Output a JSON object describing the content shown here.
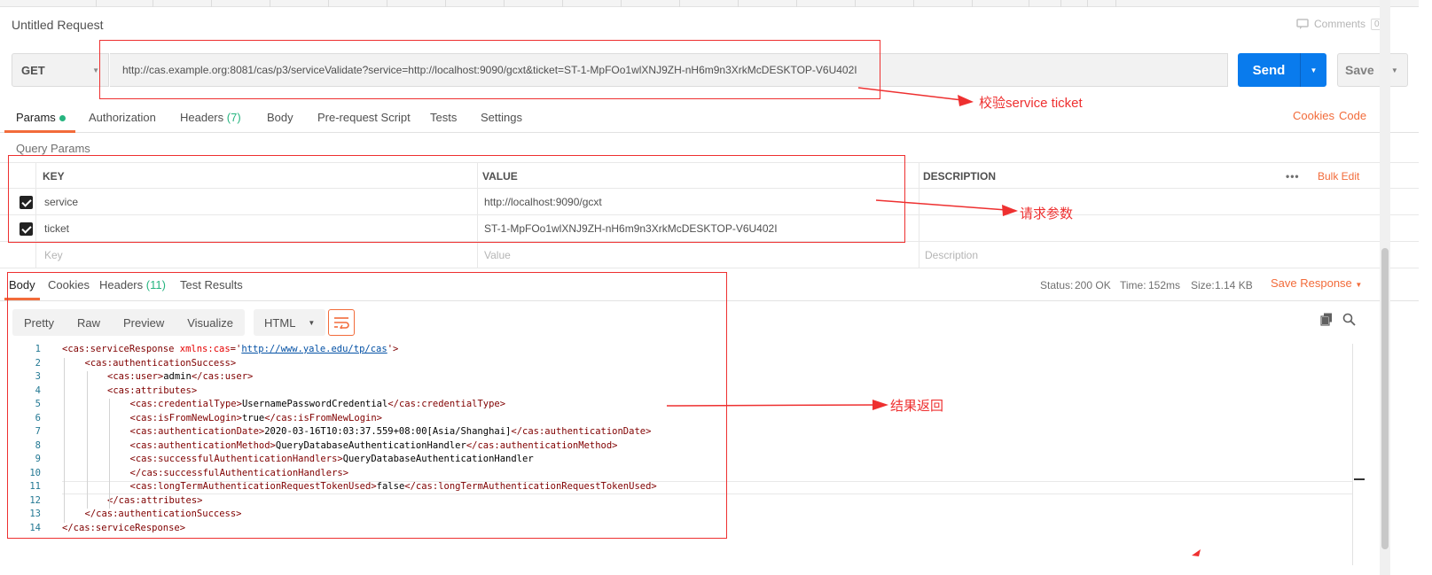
{
  "request": {
    "title": "Untitled Request",
    "comments_label": "Comments",
    "comments_count": "0",
    "method": "GET",
    "url": "http://cas.example.org:8081/cas/p3/serviceValidate?service=http://localhost:9090/gcxt&ticket=ST-1-MpFOo1wlXNJ9ZH-nH6m9n3XrkMcDESKTOP-V6U402I",
    "send_label": "Send",
    "save_label": "Save"
  },
  "request_tabs": {
    "params": "Params",
    "authorization": "Authorization",
    "headers": "Headers",
    "headers_count": "(7)",
    "body": "Body",
    "prerequest": "Pre-request Script",
    "tests": "Tests",
    "settings": "Settings",
    "cookies": "Cookies",
    "code": "Code"
  },
  "query_params": {
    "label": "Query Params",
    "headers": {
      "key": "KEY",
      "value": "VALUE",
      "description": "DESCRIPTION",
      "bulk_edit": "Bulk Edit"
    },
    "rows": [
      {
        "checked": true,
        "key": "service",
        "value": "http://localhost:9090/gcxt"
      },
      {
        "checked": true,
        "key": "ticket",
        "value": "ST-1-MpFOo1wlXNJ9ZH-nH6m9n3XrkMcDESKTOP-V6U402I"
      }
    ],
    "placeholder": {
      "key": "Key",
      "value": "Value",
      "description": "Description"
    }
  },
  "response_tabs": {
    "body": "Body",
    "cookies": "Cookies",
    "headers": "Headers",
    "headers_count": "(11)",
    "test_results": "Test Results"
  },
  "response_status": {
    "status_label": "Status:",
    "status_value": "200 OK",
    "time_label": "Time:",
    "time_value": "152ms",
    "size_label": "Size:",
    "size_value": "1.14 KB",
    "save_response": "Save Response"
  },
  "format_bar": {
    "pretty": "Pretty",
    "raw": "Raw",
    "preview": "Preview",
    "visualize": "Visualize",
    "language": "HTML"
  },
  "code_lines": [
    {
      "n": "1",
      "indent": 0,
      "parts": [
        [
          "t",
          "<cas:serviceResponse "
        ],
        [
          "a",
          "xmlns:cas"
        ],
        [
          "t",
          "='"
        ],
        [
          "s",
          "http://www.yale.edu/tp/cas"
        ],
        [
          "t",
          "'>"
        ]
      ]
    },
    {
      "n": "2",
      "indent": 1,
      "parts": [
        [
          "t",
          "<cas:authenticationSuccess>"
        ]
      ]
    },
    {
      "n": "3",
      "indent": 2,
      "parts": [
        [
          "t",
          "<cas:user>"
        ],
        [
          "p",
          "admin"
        ],
        [
          "t",
          "</cas:user>"
        ]
      ]
    },
    {
      "n": "4",
      "indent": 2,
      "parts": [
        [
          "t",
          "<cas:attributes>"
        ]
      ]
    },
    {
      "n": "5",
      "indent": 3,
      "parts": [
        [
          "t",
          "<cas:credentialType>"
        ],
        [
          "p",
          "UsernamePasswordCredential"
        ],
        [
          "t",
          "</cas:credentialType>"
        ]
      ]
    },
    {
      "n": "6",
      "indent": 3,
      "parts": [
        [
          "t",
          "<cas:isFromNewLogin>"
        ],
        [
          "p",
          "true"
        ],
        [
          "t",
          "</cas:isFromNewLogin>"
        ]
      ]
    },
    {
      "n": "7",
      "indent": 3,
      "parts": [
        [
          "t",
          "<cas:authenticationDate>"
        ],
        [
          "p",
          "2020-03-16T10:03:37.559+08:00[Asia/Shanghai]"
        ],
        [
          "t",
          "</cas:authenticationDate>"
        ]
      ]
    },
    {
      "n": "8",
      "indent": 3,
      "parts": [
        [
          "t",
          "<cas:authenticationMethod>"
        ],
        [
          "p",
          "QueryDatabaseAuthenticationHandler"
        ],
        [
          "t",
          "</cas:authenticationMethod>"
        ]
      ]
    },
    {
      "n": "9",
      "indent": 3,
      "parts": [
        [
          "t",
          "<cas:successfulAuthenticationHandlers>"
        ],
        [
          "p",
          "QueryDatabaseAuthenticationHandler"
        ]
      ]
    },
    {
      "n": "10",
      "indent": 3,
      "parts": [
        [
          "t",
          "</cas:successfulAuthenticationHandlers>"
        ]
      ]
    },
    {
      "n": "11",
      "indent": 3,
      "parts": [
        [
          "t",
          "<cas:longTermAuthenticationRequestTokenUsed>"
        ],
        [
          "p",
          "false"
        ],
        [
          "t",
          "</cas:longTermAuthenticationRequestTokenUsed>"
        ]
      ]
    },
    {
      "n": "12",
      "indent": 2,
      "parts": [
        [
          "t",
          "</cas:attributes>"
        ]
      ]
    },
    {
      "n": "13",
      "indent": 1,
      "parts": [
        [
          "t",
          "</cas:authenticationSuccess>"
        ]
      ]
    },
    {
      "n": "14",
      "indent": 0,
      "parts": [
        [
          "t",
          "</cas:serviceResponse>"
        ]
      ]
    }
  ],
  "annotations": {
    "verify_ticket": "校验service ticket",
    "request_params": "请求参数",
    "result_return": "结果返回"
  },
  "colors": {
    "accent_orange": "#f26b3a",
    "send_blue": "#097bed",
    "status_green": "#26b47f",
    "annotation_red": "#ee3030"
  }
}
